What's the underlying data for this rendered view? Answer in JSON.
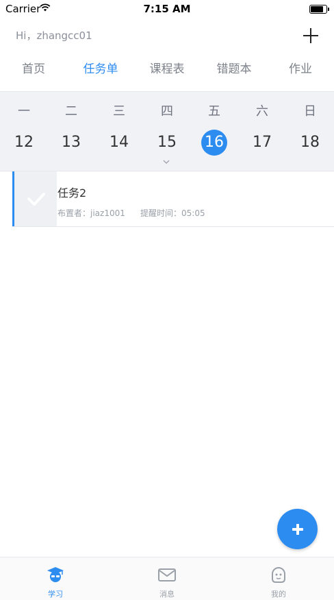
{
  "status_bar": {
    "carrier": "Carrier",
    "time": "7:15 AM",
    "battery_level": 0.9
  },
  "header": {
    "greeting": "Hi，zhangcc01"
  },
  "tabs": [
    {
      "label": "首页",
      "active": false
    },
    {
      "label": "任务单",
      "active": true
    },
    {
      "label": "课程表",
      "active": false
    },
    {
      "label": "错题本",
      "active": false
    },
    {
      "label": "作业",
      "active": false
    }
  ],
  "calendar": {
    "weekdays": [
      "一",
      "二",
      "三",
      "四",
      "五",
      "六",
      "日"
    ],
    "days": [
      "12",
      "13",
      "14",
      "15",
      "16",
      "17",
      "18"
    ],
    "selected_day": "16"
  },
  "tasks": [
    {
      "title": "任务2",
      "assigner": "布置者：jiaz1001",
      "reminder": "提醒时间：05:05"
    }
  ],
  "bottom_nav": [
    {
      "label": "学习",
      "icon": "graduation-cap-icon",
      "active": true
    },
    {
      "label": "消息",
      "icon": "mail-icon",
      "active": false
    },
    {
      "label": "我的",
      "icon": "user-face-icon",
      "active": false
    }
  ],
  "colors": {
    "accent": "#2d8cf0",
    "inactive": "#9aa0a8",
    "calendar_bg": "#f1f2f6"
  }
}
